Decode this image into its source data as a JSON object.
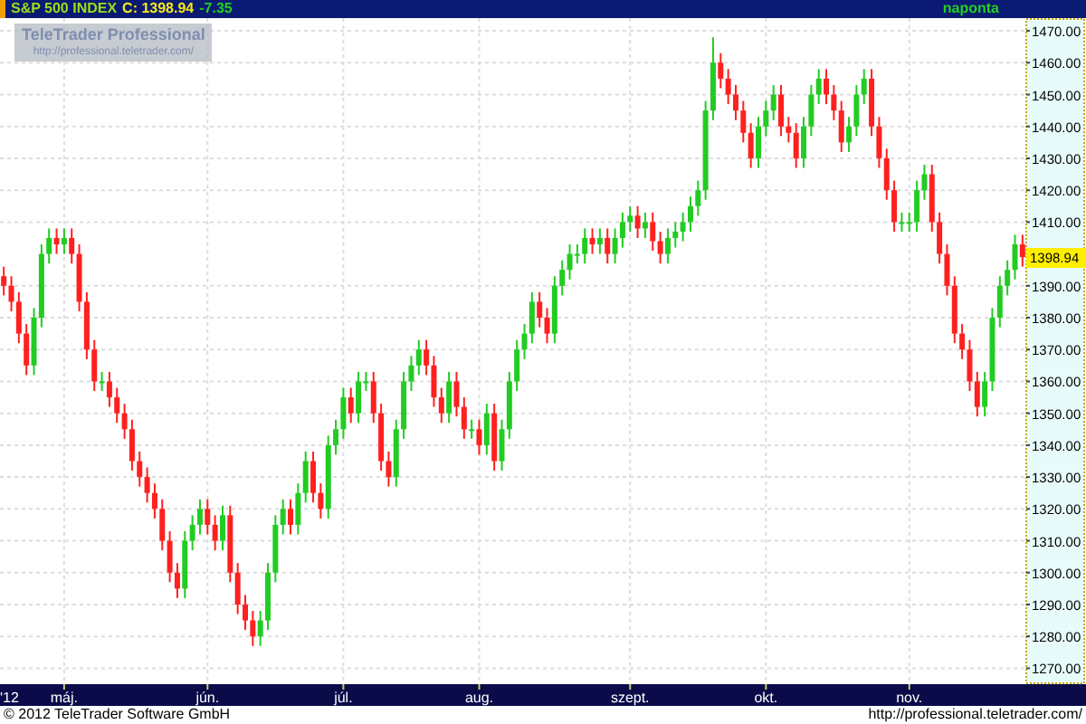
{
  "header": {
    "title": "S&P 500 INDEX",
    "close": "C: 1398.94",
    "change": "-7.35",
    "period": "naponta"
  },
  "logo": {
    "name": "TeleTrader Professional",
    "url": "http://professional.teletrader.com/"
  },
  "chart": {
    "price_tag": "1398.94",
    "chart_data": {
      "type": "candlestick",
      "grid": true,
      "ylim": [
        1265,
        1474
      ],
      "yticks": [
        {
          "value": 1270,
          "label": "1270.00"
        },
        {
          "value": 1280,
          "label": "1280.00"
        },
        {
          "value": 1290,
          "label": "1290.00"
        },
        {
          "value": 1300,
          "label": "1300.00"
        },
        {
          "value": 1310,
          "label": "1310.00"
        },
        {
          "value": 1320,
          "label": "1320.00"
        },
        {
          "value": 1330,
          "label": "1330.00"
        },
        {
          "value": 1340,
          "label": "1340.00"
        },
        {
          "value": 1350,
          "label": "1350.00"
        },
        {
          "value": 1360,
          "label": "1360.00"
        },
        {
          "value": 1370,
          "label": "1370.00"
        },
        {
          "value": 1380,
          "label": "1380.00"
        },
        {
          "value": 1390,
          "label": "1390.00"
        },
        {
          "value": 1410,
          "label": "1410.00"
        },
        {
          "value": 1420,
          "label": "1420.00"
        },
        {
          "value": 1430,
          "label": "1430.00"
        },
        {
          "value": 1440,
          "label": "1440.00"
        },
        {
          "value": 1450,
          "label": "1450.00"
        },
        {
          "value": 1460,
          "label": "1460.00"
        },
        {
          "value": 1470,
          "label": "1470.00"
        }
      ],
      "categories": [
        "'12",
        null,
        null,
        null,
        null,
        null,
        null,
        null,
        "máj.",
        null,
        null,
        null,
        null,
        null,
        null,
        null,
        null,
        null,
        null,
        null,
        null,
        null,
        null,
        null,
        null,
        null,
        null,
        "jún.",
        null,
        null,
        null,
        null,
        null,
        null,
        null,
        null,
        null,
        null,
        null,
        null,
        null,
        null,
        null,
        null,
        null,
        "júl.",
        null,
        null,
        null,
        null,
        null,
        null,
        null,
        null,
        null,
        null,
        null,
        null,
        null,
        null,
        null,
        null,
        null,
        "aug.",
        null,
        null,
        null,
        null,
        null,
        null,
        null,
        null,
        null,
        null,
        null,
        null,
        null,
        null,
        null,
        null,
        null,
        null,
        null,
        "szept.",
        null,
        null,
        null,
        null,
        null,
        null,
        null,
        null,
        null,
        null,
        null,
        null,
        null,
        null,
        null,
        null,
        null,
        "okt.",
        null,
        null,
        null,
        null,
        null,
        null,
        null,
        null,
        null,
        null,
        null,
        null,
        null,
        null,
        null,
        null,
        null,
        null,
        "nov.",
        null,
        null,
        null,
        null,
        null,
        null,
        null,
        null,
        null,
        null,
        null,
        null,
        null,
        null,
        null
      ],
      "ohlc": [
        [
          1393,
          1396,
          1387,
          1390
        ],
        [
          1390,
          1393,
          1382,
          1385
        ],
        [
          1385,
          1388,
          1372,
          1375
        ],
        [
          1375,
          1378,
          1362,
          1365
        ],
        [
          1365,
          1383,
          1362,
          1380
        ],
        [
          1380,
          1403,
          1377,
          1400
        ],
        [
          1400,
          1408,
          1397,
          1405
        ],
        [
          1405,
          1408,
          1400,
          1403
        ],
        [
          1403,
          1408,
          1400,
          1405
        ],
        [
          1405,
          1408,
          1397,
          1400
        ],
        [
          1400,
          1403,
          1382,
          1385
        ],
        [
          1385,
          1388,
          1367,
          1370
        ],
        [
          1370,
          1373,
          1357,
          1360
        ],
        [
          1360,
          1363,
          1357,
          1360
        ],
        [
          1360,
          1363,
          1352,
          1355
        ],
        [
          1355,
          1358,
          1347,
          1350
        ],
        [
          1350,
          1353,
          1342,
          1345
        ],
        [
          1345,
          1348,
          1332,
          1335
        ],
        [
          1335,
          1338,
          1327,
          1330
        ],
        [
          1330,
          1333,
          1322,
          1325
        ],
        [
          1325,
          1328,
          1317,
          1320
        ],
        [
          1320,
          1323,
          1307,
          1310
        ],
        [
          1310,
          1313,
          1297,
          1300
        ],
        [
          1300,
          1303,
          1292,
          1295
        ],
        [
          1295,
          1313,
          1292,
          1310
        ],
        [
          1310,
          1318,
          1307,
          1315
        ],
        [
          1315,
          1323,
          1312,
          1320
        ],
        [
          1320,
          1323,
          1312,
          1315
        ],
        [
          1315,
          1318,
          1307,
          1310
        ],
        [
          1310,
          1321,
          1307,
          1318
        ],
        [
          1318,
          1321,
          1297,
          1300
        ],
        [
          1300,
          1303,
          1287,
          1290
        ],
        [
          1290,
          1293,
          1282,
          1285
        ],
        [
          1285,
          1288,
          1277,
          1280
        ],
        [
          1280,
          1288,
          1277,
          1285
        ],
        [
          1285,
          1303,
          1282,
          1300
        ],
        [
          1300,
          1318,
          1297,
          1315
        ],
        [
          1315,
          1323,
          1312,
          1320
        ],
        [
          1320,
          1323,
          1312,
          1315
        ],
        [
          1315,
          1328,
          1312,
          1325
        ],
        [
          1325,
          1338,
          1322,
          1335
        ],
        [
          1335,
          1338,
          1322,
          1325
        ],
        [
          1325,
          1328,
          1317,
          1320
        ],
        [
          1320,
          1343,
          1317,
          1340
        ],
        [
          1340,
          1348,
          1337,
          1345
        ],
        [
          1345,
          1358,
          1342,
          1355
        ],
        [
          1355,
          1358,
          1347,
          1350
        ],
        [
          1350,
          1363,
          1347,
          1360
        ],
        [
          1360,
          1363,
          1357,
          1360
        ],
        [
          1360,
          1363,
          1347,
          1350
        ],
        [
          1350,
          1353,
          1332,
          1335
        ],
        [
          1335,
          1338,
          1327,
          1330
        ],
        [
          1330,
          1348,
          1327,
          1345
        ],
        [
          1345,
          1363,
          1342,
          1360
        ],
        [
          1360,
          1368,
          1357,
          1365
        ],
        [
          1365,
          1373,
          1362,
          1370
        ],
        [
          1370,
          1373,
          1362,
          1365
        ],
        [
          1365,
          1368,
          1352,
          1355
        ],
        [
          1355,
          1358,
          1347,
          1350
        ],
        [
          1350,
          1363,
          1347,
          1360
        ],
        [
          1360,
          1363,
          1349,
          1352
        ],
        [
          1352,
          1355,
          1342,
          1345
        ],
        [
          1345,
          1348,
          1342,
          1345
        ],
        [
          1345,
          1348,
          1337,
          1340
        ],
        [
          1340,
          1353,
          1337,
          1350
        ],
        [
          1350,
          1353,
          1332,
          1335
        ],
        [
          1335,
          1348,
          1332,
          1345
        ],
        [
          1345,
          1363,
          1342,
          1360
        ],
        [
          1360,
          1373,
          1357,
          1370
        ],
        [
          1370,
          1378,
          1367,
          1375
        ],
        [
          1375,
          1388,
          1372,
          1385
        ],
        [
          1385,
          1388,
          1377,
          1380
        ],
        [
          1380,
          1383,
          1372,
          1375
        ],
        [
          1375,
          1393,
          1372,
          1390
        ],
        [
          1390,
          1398,
          1387,
          1395
        ],
        [
          1395,
          1403,
          1392,
          1400
        ],
        [
          1400,
          1403,
          1397,
          1400
        ],
        [
          1400,
          1408,
          1397,
          1405
        ],
        [
          1405,
          1408,
          1400,
          1403
        ],
        [
          1403,
          1408,
          1400,
          1405
        ],
        [
          1405,
          1408,
          1397,
          1400
        ],
        [
          1400,
          1408,
          1397,
          1405
        ],
        [
          1405,
          1413,
          1402,
          1410
        ],
        [
          1410,
          1415,
          1407,
          1412
        ],
        [
          1412,
          1415,
          1405,
          1408
        ],
        [
          1408,
          1413,
          1405,
          1410
        ],
        [
          1410,
          1413,
          1401,
          1404
        ],
        [
          1404,
          1407,
          1397,
          1400
        ],
        [
          1400,
          1408,
          1397,
          1405
        ],
        [
          1405,
          1410,
          1402,
          1407
        ],
        [
          1407,
          1413,
          1404,
          1410
        ],
        [
          1410,
          1418,
          1407,
          1415
        ],
        [
          1415,
          1423,
          1412,
          1420
        ],
        [
          1420,
          1448,
          1417,
          1445
        ],
        [
          1445,
          1468,
          1442,
          1460
        ],
        [
          1460,
          1463,
          1452,
          1455
        ],
        [
          1455,
          1458,
          1447,
          1450
        ],
        [
          1450,
          1453,
          1442,
          1445
        ],
        [
          1445,
          1448,
          1435,
          1438
        ],
        [
          1438,
          1441,
          1427,
          1430
        ],
        [
          1430,
          1443,
          1427,
          1440
        ],
        [
          1440,
          1448,
          1437,
          1445
        ],
        [
          1445,
          1453,
          1442,
          1450
        ],
        [
          1450,
          1453,
          1437,
          1440
        ],
        [
          1440,
          1443,
          1435,
          1438
        ],
        [
          1438,
          1441,
          1427,
          1430
        ],
        [
          1430,
          1443,
          1427,
          1440
        ],
        [
          1440,
          1453,
          1437,
          1450
        ],
        [
          1450,
          1458,
          1447,
          1455
        ],
        [
          1455,
          1458,
          1447,
          1450
        ],
        [
          1450,
          1453,
          1442,
          1445
        ],
        [
          1445,
          1448,
          1432,
          1435
        ],
        [
          1435,
          1443,
          1432,
          1440
        ],
        [
          1440,
          1453,
          1437,
          1450
        ],
        [
          1450,
          1458,
          1447,
          1455
        ],
        [
          1455,
          1458,
          1437,
          1440
        ],
        [
          1440,
          1443,
          1427,
          1430
        ],
        [
          1430,
          1433,
          1417,
          1420
        ],
        [
          1420,
          1423,
          1407,
          1410
        ],
        [
          1410,
          1413,
          1407,
          1410
        ],
        [
          1410,
          1413,
          1407,
          1410
        ],
        [
          1410,
          1423,
          1407,
          1420
        ],
        [
          1420,
          1428,
          1417,
          1425
        ],
        [
          1425,
          1428,
          1407,
          1410
        ],
        [
          1410,
          1413,
          1397,
          1400
        ],
        [
          1400,
          1403,
          1387,
          1390
        ],
        [
          1390,
          1393,
          1372,
          1375
        ],
        [
          1375,
          1378,
          1367,
          1370
        ],
        [
          1370,
          1373,
          1357,
          1360
        ],
        [
          1360,
          1363,
          1349,
          1352
        ],
        [
          1352,
          1363,
          1349,
          1360
        ],
        [
          1360,
          1383,
          1357,
          1380
        ],
        [
          1380,
          1393,
          1377,
          1390
        ],
        [
          1390,
          1398,
          1387,
          1395
        ],
        [
          1395,
          1406,
          1392,
          1403
        ],
        [
          1403,
          1406,
          1396,
          1399
        ]
      ]
    }
  },
  "footer": {
    "copyright": "© 2012 TeleTrader Software GmbH",
    "url": "http://professional.teletrader.com/"
  }
}
